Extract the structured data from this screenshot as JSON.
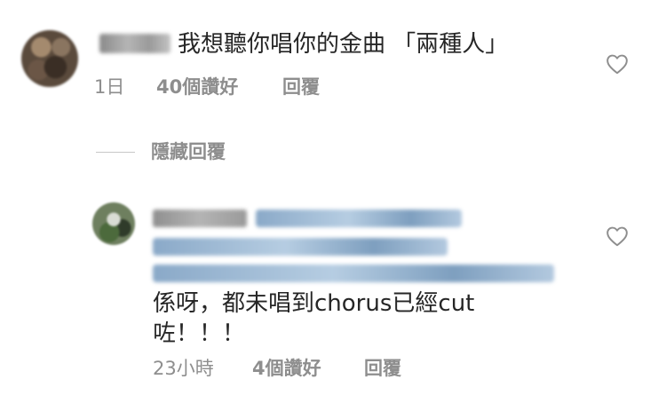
{
  "comment1": {
    "text": "我想聽你唱你的金曲 「兩種人」",
    "time": "1日",
    "likes": "40個讚好",
    "reply_label": "回覆"
  },
  "hide_replies_label": "隱藏回覆",
  "comment2": {
    "text": "係呀，都未唱到chorus已經cut咗！！！",
    "time": "23小時",
    "likes": "4個讚好",
    "reply_label": "回覆"
  },
  "icons": {
    "like": "heart-outline-icon"
  },
  "colors": {
    "text_primary": "#262626",
    "text_secondary": "#8e8e8e",
    "mention_blue": "#9fb9d4"
  }
}
